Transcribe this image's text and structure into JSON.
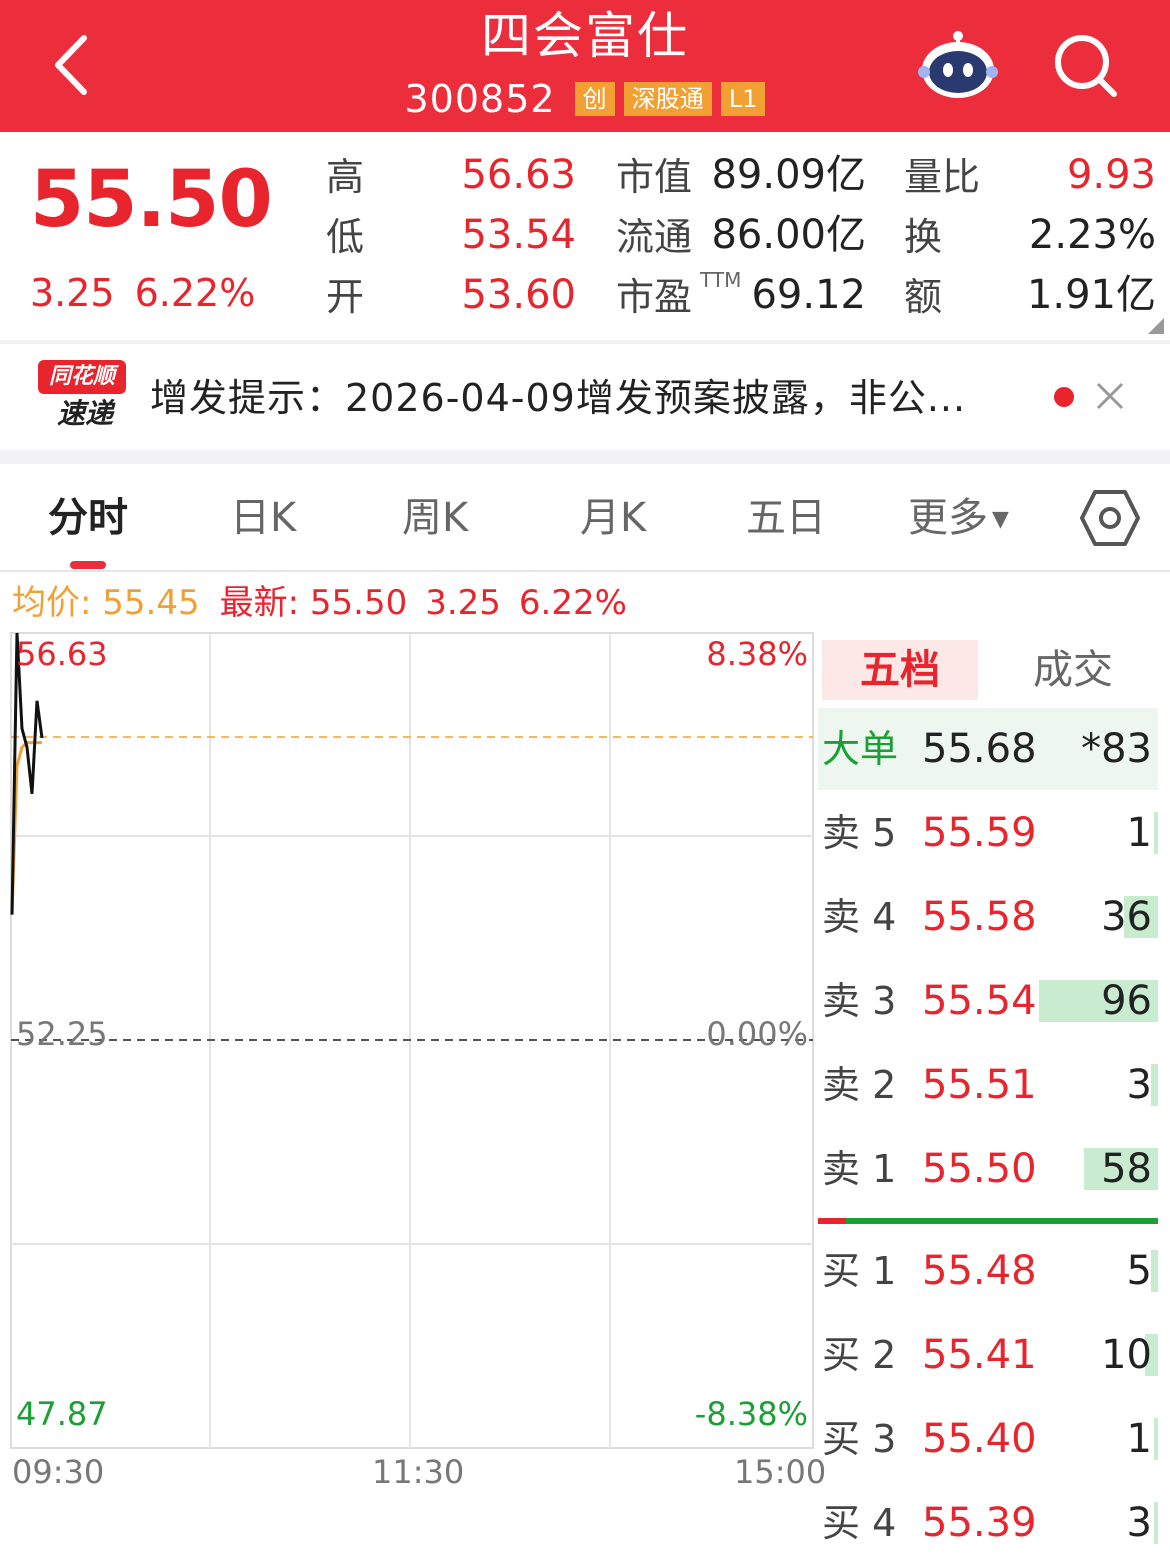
{
  "header": {
    "title": "四会富仕",
    "code": "300852",
    "tags": [
      "创",
      "深股通",
      "L1"
    ]
  },
  "quote": {
    "price": "55.50",
    "change": "3.25",
    "change_pct": "6.22%",
    "stats": [
      {
        "label": "高",
        "value": "56.63"
      },
      {
        "label": "低",
        "value": "53.54"
      },
      {
        "label": "开",
        "value": "53.60"
      },
      {
        "label": "市值",
        "value": "89.09亿"
      },
      {
        "label": "流通",
        "value": "86.00亿"
      },
      {
        "label": "市盈",
        "sup": "TTM",
        "value": "69.12"
      },
      {
        "label": "量比",
        "value": "9.93"
      },
      {
        "label": "换",
        "value": "2.23%"
      },
      {
        "label": "额",
        "value": "1.91亿"
      }
    ]
  },
  "news": {
    "logo_top": "同花顺",
    "logo_bottom": "速递",
    "text": "增发提示：2026-04-09增发预案披露，非公..."
  },
  "tabs": [
    "分时",
    "日K",
    "周K",
    "月K",
    "五日",
    "更多"
  ],
  "chart_info": {
    "avg_label": "均价: 55.45",
    "latest_label": "最新: 55.50",
    "change": "3.25",
    "change_pct": "6.22%"
  },
  "chart_data": {
    "type": "line",
    "x_ticks": [
      "09:30",
      "11:30",
      "15:00"
    ],
    "y_left": [
      "56.63",
      "52.25",
      "47.87"
    ],
    "y_right": [
      "8.38%",
      "0.00%",
      "-8.38%"
    ],
    "ylim": [
      47.87,
      56.63
    ],
    "prev_close": 52.25,
    "series": [
      {
        "color": "#111111",
        "values": [
          53.6,
          56.63,
          55.6,
          55.4,
          54.9,
          55.9,
          55.5
        ]
      },
      {
        "color": "#f2a033",
        "values": [
          53.6,
          55.2,
          55.4,
          55.45,
          55.45,
          55.45,
          55.45
        ]
      }
    ]
  },
  "order_book": {
    "tabs": [
      "五档",
      "成交"
    ],
    "big_order": {
      "label": "大单",
      "price": "55.68",
      "vol": "*83"
    },
    "asks": [
      {
        "name": "卖 5",
        "price": "55.59",
        "vol": "1",
        "bar": 0.01
      },
      {
        "name": "卖 4",
        "price": "55.58",
        "vol": "36",
        "bar": 0.15
      },
      {
        "name": "卖 3",
        "price": "55.54",
        "vol": "96",
        "bar": 0.53
      },
      {
        "name": "卖 2",
        "price": "55.51",
        "vol": "3",
        "bar": 0.03
      },
      {
        "name": "卖 1",
        "price": "55.50",
        "vol": "58",
        "bar": 0.33
      }
    ],
    "bids": [
      {
        "name": "买 1",
        "price": "55.48",
        "vol": "5",
        "bar": 0.03
      },
      {
        "name": "买 2",
        "price": "55.41",
        "vol": "10",
        "bar": 0.06
      },
      {
        "name": "买 3",
        "price": "55.40",
        "vol": "1",
        "bar": 0.01
      },
      {
        "name": "买 4",
        "price": "55.39",
        "vol": "3",
        "bar": 0.02
      }
    ]
  }
}
